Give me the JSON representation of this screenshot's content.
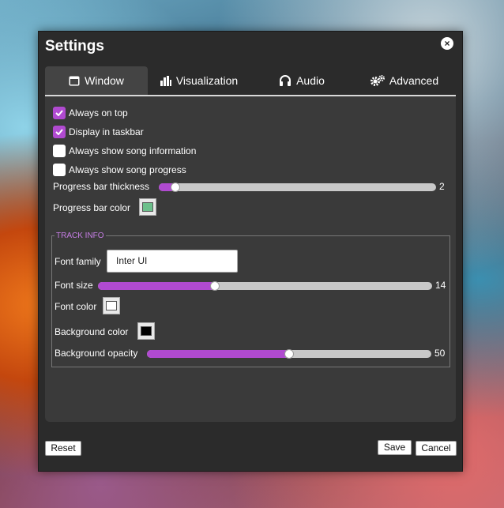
{
  "dialog": {
    "title": "Settings",
    "close_glyph": "×"
  },
  "tabs": [
    {
      "label": "Window",
      "icon": "window-icon",
      "active": true
    },
    {
      "label": "Visualization",
      "icon": "bar-chart-icon",
      "active": false
    },
    {
      "label": "Audio",
      "icon": "headphones-icon",
      "active": false
    },
    {
      "label": "Advanced",
      "icon": "gears-icon",
      "active": false
    }
  ],
  "window": {
    "always_on_top": {
      "label": "Always on top",
      "checked": true
    },
    "display_in_taskbar": {
      "label": "Display in taskbar",
      "checked": true
    },
    "show_song_info": {
      "label": "Always show song information",
      "checked": false
    },
    "show_song_progress": {
      "label": "Always show song progress",
      "checked": false
    },
    "progress_thickness": {
      "label": "Progress bar thickness",
      "value": "2",
      "fraction": 0.06
    },
    "progress_color": {
      "label": "Progress bar color",
      "color": "#6cc08b"
    }
  },
  "track_info": {
    "legend": "TRACK INFO",
    "font_family": {
      "label": "Font family",
      "value": "Inter UI"
    },
    "font_size": {
      "label": "Font size",
      "value": "14",
      "fraction": 0.35
    },
    "font_color": {
      "label": "Font color",
      "color": "#ffffff"
    },
    "background_color": {
      "label": "Background color",
      "color": "#000000"
    },
    "background_opacity": {
      "label": "Background opacity",
      "value": "50",
      "fraction": 0.5
    }
  },
  "buttons": {
    "reset": "Reset",
    "save": "Save",
    "cancel": "Cancel"
  },
  "colors": {
    "accent": "#b04ad0",
    "dialog_bg": "#2b2b2b",
    "panel_bg": "#3a3a3a"
  }
}
